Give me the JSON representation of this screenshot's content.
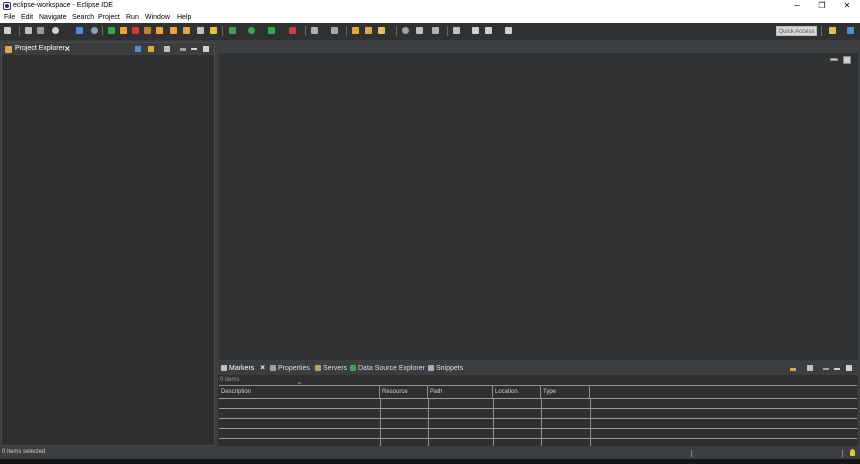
{
  "window": {
    "title": "eclipse-workspace - Eclipse IDE",
    "controls": [
      "−",
      "❐",
      "✕"
    ]
  },
  "menu": [
    "File",
    "Edit",
    "Navigate",
    "Search",
    "Project",
    "Run",
    "Window",
    "Help"
  ],
  "toolbar": {
    "quick_access_placeholder": "Quick Access"
  },
  "project_explorer": {
    "title": "Project Explorer"
  },
  "bottom_panel": {
    "tabs": [
      {
        "label": "Markers",
        "active": true,
        "icon": "markers-icon"
      },
      {
        "label": "Properties",
        "active": false,
        "icon": "properties-icon"
      },
      {
        "label": "Servers",
        "active": false,
        "icon": "servers-icon"
      },
      {
        "label": "Data Source Explorer",
        "active": false,
        "icon": "data-source-icon"
      },
      {
        "label": "Snippets",
        "active": false,
        "icon": "snippets-icon"
      }
    ],
    "items_count": "0 items",
    "columns": [
      "Description",
      "Resource",
      "Path",
      "Location",
      "Type"
    ]
  },
  "status": {
    "text": "0 items selected"
  },
  "colors": {
    "accent_orange": "#e8a33a",
    "accent_green": "#3aa64a",
    "accent_red": "#d23b2f",
    "accent_blue": "#3b7dd8"
  }
}
